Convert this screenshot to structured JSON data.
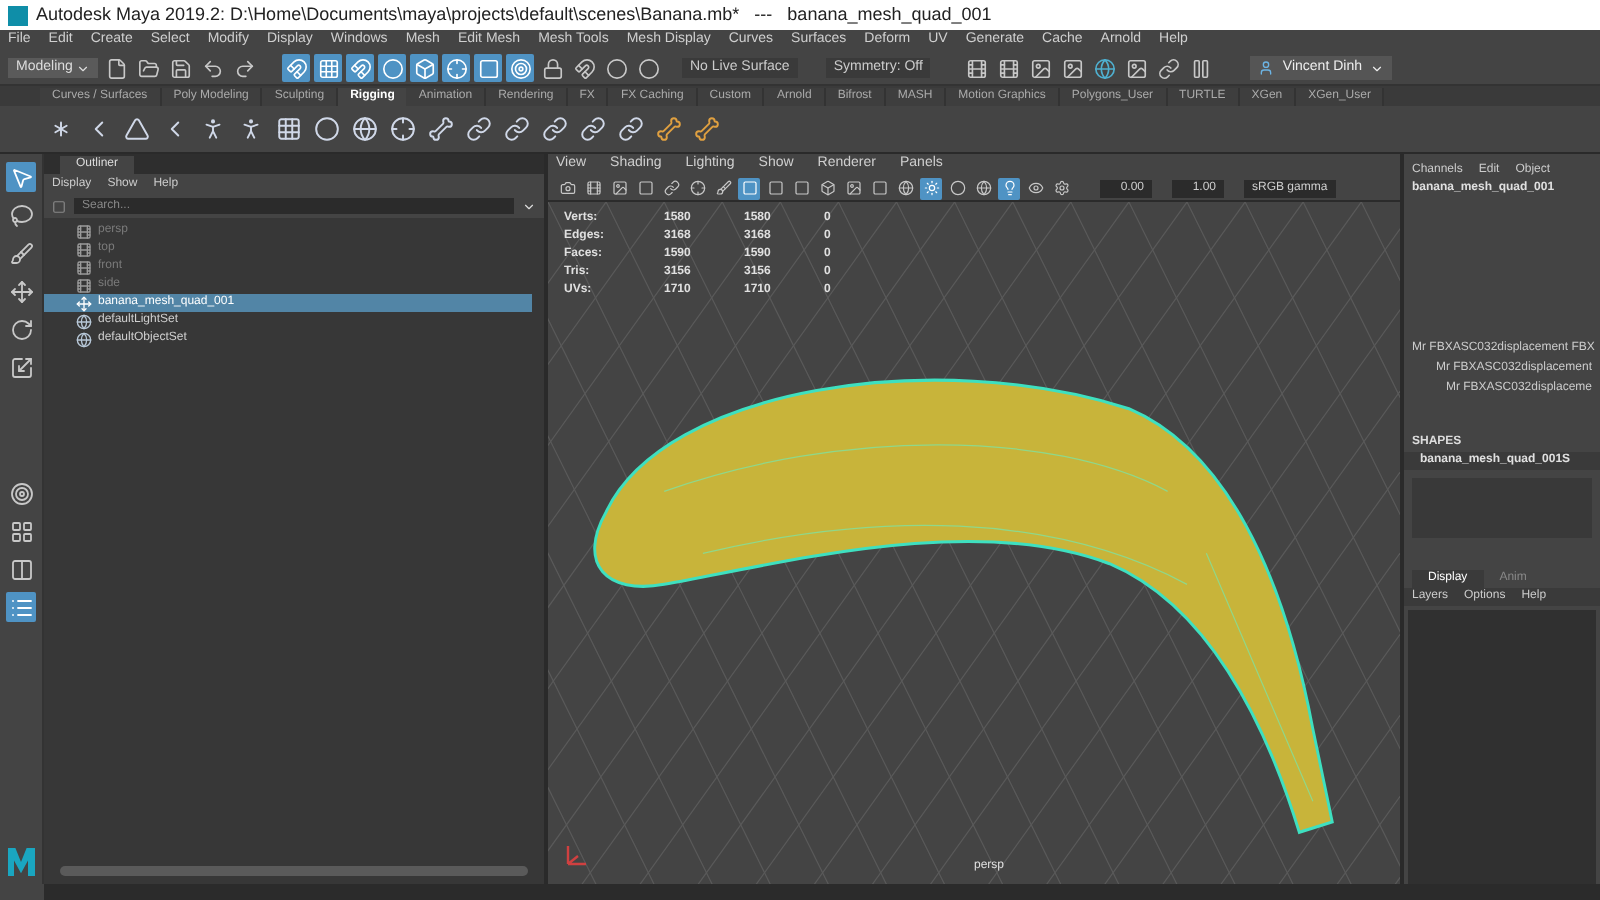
{
  "window": {
    "title": "Autodesk Maya 2019.2: D:\\Home\\Documents\\maya\\projects\\default\\scenes\\Banana.mb*   ---   banana_mesh_quad_001"
  },
  "menu": [
    "File",
    "Edit",
    "Create",
    "Select",
    "Modify",
    "Display",
    "Windows",
    "Mesh",
    "Edit Mesh",
    "Mesh Tools",
    "Mesh Display",
    "Curves",
    "Surfaces",
    "Deform",
    "UV",
    "Generate",
    "Cache",
    "Arnold",
    "Help"
  ],
  "status_line": {
    "menu_set": "Modeling",
    "snap_buttons": [
      {
        "selected": true
      },
      {
        "selected": true
      },
      {
        "selected": true
      },
      {
        "selected": true
      },
      {
        "selected": true
      },
      {
        "selected": true
      },
      {
        "selected": true
      },
      {
        "selected": true
      }
    ],
    "live_surface": "No Live Surface",
    "symmetry": "Symmetry: Off",
    "user": "Vincent Dinh"
  },
  "shelf": {
    "tabs": [
      {
        "label": "Curves / Surfaces",
        "selected": false
      },
      {
        "label": "Poly Modeling",
        "selected": false
      },
      {
        "label": "Sculpting",
        "selected": false
      },
      {
        "label": "Rigging",
        "selected": true
      },
      {
        "label": "Animation",
        "selected": false
      },
      {
        "label": "Rendering",
        "selected": false
      },
      {
        "label": "FX",
        "selected": false
      },
      {
        "label": "FX Caching",
        "selected": false
      },
      {
        "label": "Custom",
        "selected": false
      },
      {
        "label": "Arnold",
        "selected": false
      },
      {
        "label": "Bifrost",
        "selected": false
      },
      {
        "label": "MASH",
        "selected": false
      },
      {
        "label": "Motion Graphics",
        "selected": false
      },
      {
        "label": "Polygons_User",
        "selected": false
      },
      {
        "label": "TURTLE",
        "selected": false
      },
      {
        "label": "XGen",
        "selected": false
      },
      {
        "label": "XGen_User",
        "selected": false
      }
    ]
  },
  "tools": [
    {
      "selected": true
    },
    {
      "selected": false
    },
    {
      "selected": false
    },
    {
      "selected": false
    },
    {
      "selected": false
    },
    {
      "selected": false
    }
  ],
  "layouts": [
    {
      "selected": false
    },
    {
      "selected": false
    },
    {
      "selected": false
    },
    {
      "selected": true
    }
  ],
  "outliner": {
    "tab": "Outliner",
    "menu": [
      "Display",
      "Show",
      "Help"
    ],
    "search": {
      "placeholder": "Search..."
    },
    "items": [
      {
        "label": "persp",
        "kind": "camera",
        "selected": false,
        "disabled": true
      },
      {
        "label": "top",
        "kind": "camera",
        "selected": false,
        "disabled": true
      },
      {
        "label": "front",
        "kind": "camera",
        "selected": false,
        "disabled": true
      },
      {
        "label": "side",
        "kind": "camera",
        "selected": false,
        "disabled": true
      },
      {
        "label": "banana_mesh_quad_001",
        "kind": "transform",
        "selected": true,
        "disabled": false
      },
      {
        "label": "defaultLightSet",
        "kind": "set",
        "selected": false,
        "disabled": false
      },
      {
        "label": "defaultObjectSet",
        "kind": "set",
        "selected": false,
        "disabled": false
      }
    ]
  },
  "viewport": {
    "menu": [
      "View",
      "Shading",
      "Lighting",
      "Show",
      "Renderer",
      "Panels"
    ],
    "toolbar_buttons": [
      {
        "selected": false
      },
      {
        "selected": false
      },
      {
        "selected": false
      },
      {
        "selected": false
      },
      {
        "selected": false
      },
      {
        "selected": false
      },
      {
        "selected": false
      },
      {
        "selected": true
      },
      {
        "selected": false
      },
      {
        "selected": false
      },
      {
        "selected": false
      },
      {
        "selected": false
      },
      {
        "selected": false
      },
      {
        "selected": false
      },
      {
        "selected": true
      },
      {
        "selected": false
      },
      {
        "selected": false
      },
      {
        "selected": true
      },
      {
        "selected": false
      },
      {
        "selected": false
      }
    ],
    "exposure": "0.00",
    "gamma": "1.00",
    "color_space": "sRGB gamma",
    "stats": [
      {
        "label": "Verts:",
        "values": [
          "1580",
          "1580",
          "0"
        ]
      },
      {
        "label": "Edges:",
        "values": [
          "3168",
          "3168",
          "0"
        ]
      },
      {
        "label": "Faces:",
        "values": [
          "1590",
          "1590",
          "0"
        ]
      },
      {
        "label": "Tris:",
        "values": [
          "3156",
          "3156",
          "0"
        ]
      },
      {
        "label": "UVs:",
        "values": [
          "1710",
          "1710",
          "0"
        ]
      }
    ],
    "camera": "persp"
  },
  "channel_box": {
    "menu": [
      "Channels",
      "Edit",
      "Object"
    ],
    "object": "banana_mesh_quad_001",
    "attributes": [
      "Mr FBXASC032displacement FBX",
      "Mr FBXASC032displacement",
      "Mr FBXASC032displaceme"
    ],
    "shapes_heading": "SHAPES",
    "shape": "banana_mesh_quad_001S"
  },
  "layer_editor": {
    "tabs": [
      {
        "label": "Display",
        "selected": true
      },
      {
        "label": "Anim",
        "selected": false
      }
    ],
    "menu": [
      "Layers",
      "Options",
      "Help"
    ]
  }
}
